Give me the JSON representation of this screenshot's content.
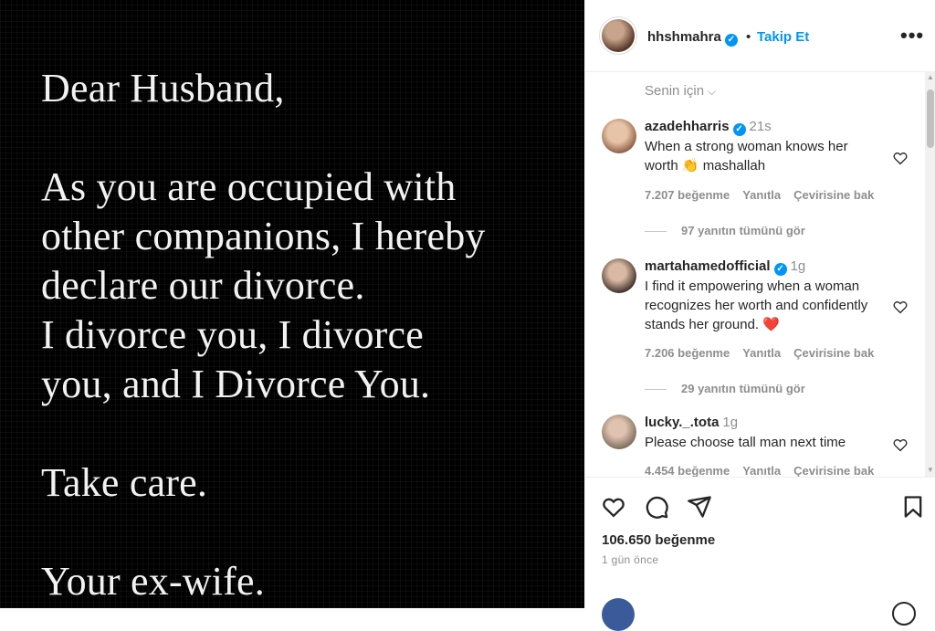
{
  "post": {
    "lines": [
      "Dear Husband,",
      "",
      "As you are occupied with",
      "other companions, I hereby",
      "declare our divorce.",
      "I divorce you, I divorce",
      "you, and I Divorce You.",
      "",
      "Take care.",
      "",
      "Your ex-wife."
    ]
  },
  "header": {
    "username": "hhshmahra",
    "verified_mark": "✓",
    "dot": "•",
    "follow_label": "Takip Et",
    "more_label": "•••"
  },
  "comments_section": {
    "sort_label": "Senin için",
    "sort_chevron": "⌵",
    "items": [
      {
        "username": "azadehharris",
        "verified_mark": "✓",
        "time": "21s",
        "text": "When a strong woman knows her worth 👏 mashallah",
        "likes": "7.207 beğenme",
        "reply": "Yanıtla",
        "translate": "Çevirisine bak",
        "view_replies": "97 yanıtın tümünü gör"
      },
      {
        "username": "martahamedofficial",
        "verified_mark": "✓",
        "time": "1g",
        "text": "I find it empowering when a woman recognizes her worth and confidently stands her ground. ❤️",
        "likes": "7.206 beğenme",
        "reply": "Yanıtla",
        "translate": "Çevirisine bak",
        "view_replies": "29 yanıtın tümünü gör"
      },
      {
        "username": "lucky._.tota",
        "time": "1g",
        "text": "Please choose tall man next time",
        "likes": "4.454 beğenme",
        "reply": "Yanıtla",
        "translate": "Çevirisine bak"
      }
    ]
  },
  "footer": {
    "like_count": "106.650 beğenme",
    "posted": "1 gün önce"
  },
  "colors": {
    "accent": "#0095f6",
    "heart_red": "#ed4956",
    "text": "#262626",
    "muted": "#8e8e8e"
  }
}
